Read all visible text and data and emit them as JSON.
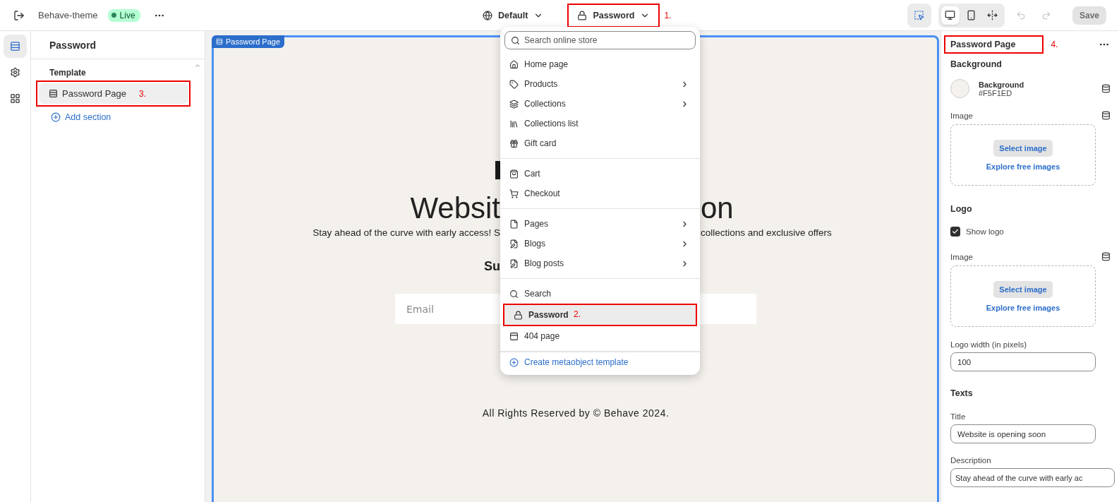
{
  "top_bar": {
    "theme_name": "Behave-theme",
    "status": "Live",
    "theme_selector": "Default",
    "template_selector": {
      "label": "Password",
      "annotation": "1."
    }
  },
  "toolbar": {
    "inspector_selected": true,
    "devices": [
      {
        "selected": true
      },
      {
        "selected": false
      },
      {
        "selected": false
      }
    ],
    "undo_disabled": true,
    "redo_disabled": true,
    "save": {
      "label": "Save",
      "disabled": true
    }
  },
  "rail": [
    {
      "selected": true
    },
    {
      "selected": false
    },
    {
      "selected": false
    }
  ],
  "sections_panel": {
    "title": "Password",
    "group": "Template",
    "items": [
      {
        "label": "Password Page",
        "selected": true,
        "annotation": "3."
      }
    ],
    "add_label": "Add section"
  },
  "preview": {
    "section_tag": "Password Page",
    "title_left": "Websit",
    "title_right": "on",
    "description_left": "Stay ahead of the curve with early access! S",
    "description_right": "collections and exclusive offers",
    "subscribe_heading": "Su",
    "email_placeholder": "Email",
    "footer": "All Rights Reserved by © Behave 2024."
  },
  "template_menu": {
    "search_placeholder": "Search online store",
    "groups": [
      [
        {
          "label": "Home page",
          "submenu": false,
          "selected": false
        },
        {
          "label": "Products",
          "submenu": true,
          "selected": false
        },
        {
          "label": "Collections",
          "submenu": true,
          "selected": false
        },
        {
          "label": "Collections list",
          "submenu": false,
          "selected": false
        },
        {
          "label": "Gift card",
          "submenu": false,
          "selected": false
        }
      ],
      [
        {
          "label": "Cart",
          "submenu": false,
          "selected": false
        },
        {
          "label": "Checkout",
          "submenu": false,
          "selected": false
        }
      ],
      [
        {
          "label": "Pages",
          "submenu": true,
          "selected": false
        },
        {
          "label": "Blogs",
          "submenu": true,
          "selected": false
        },
        {
          "label": "Blog posts",
          "submenu": true,
          "selected": false
        }
      ],
      [
        {
          "label": "Search",
          "submenu": false,
          "selected": false
        },
        {
          "label": "Password",
          "submenu": false,
          "selected": true,
          "annotation": "2."
        },
        {
          "label": "404 page",
          "submenu": false,
          "selected": false
        }
      ]
    ],
    "create_label": "Create metaobject template"
  },
  "settings": {
    "title": "Password Page",
    "annotation": "4.",
    "background": {
      "heading": "Background",
      "color_label": "Background",
      "color_value": "#F5F1ED",
      "image_label": "Image",
      "select_label": "Select image",
      "explore_label": "Explore free images"
    },
    "logo": {
      "heading": "Logo",
      "show_logo": {
        "label": "Show logo",
        "checked": true
      },
      "image_label": "Image",
      "select_label": "Select image",
      "explore_label": "Explore free images",
      "width_label": "Logo width (in pixels)",
      "width_value": "100"
    },
    "texts": {
      "heading": "Texts",
      "fields": [
        {
          "label": "Title",
          "value": "Website is opening soon"
        },
        {
          "label": "Description",
          "value": "Stay ahead of the curve with early ac"
        }
      ]
    }
  }
}
